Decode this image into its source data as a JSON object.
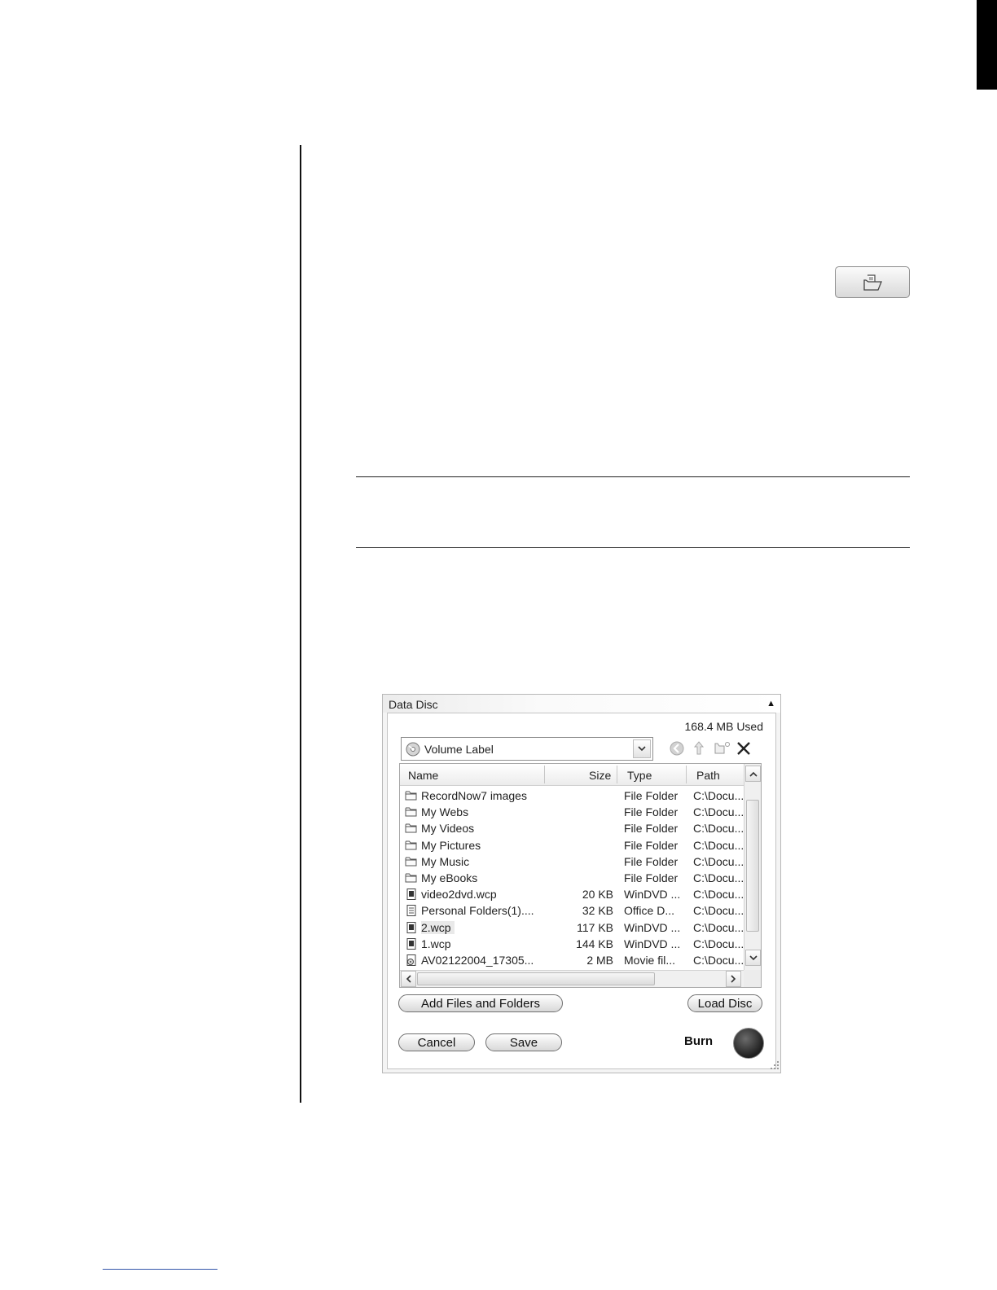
{
  "window": {
    "title": "Data Disc",
    "used": "168.4 MB Used",
    "volume_label": "Volume Label"
  },
  "columns": {
    "name": "Name",
    "size": "Size",
    "type": "Type",
    "path": "Path"
  },
  "files": [
    {
      "icon": "folder-icon",
      "name": "RecordNow7 images",
      "size": "",
      "type": "File Folder",
      "path": "C:\\Docu..."
    },
    {
      "icon": "folder-icon",
      "name": "My Webs",
      "size": "",
      "type": "File Folder",
      "path": "C:\\Docu..."
    },
    {
      "icon": "folder-icon",
      "name": "My Videos",
      "size": "",
      "type": "File Folder",
      "path": "C:\\Docu..."
    },
    {
      "icon": "folder-icon",
      "name": "My Pictures",
      "size": "",
      "type": "File Folder",
      "path": "C:\\Docu..."
    },
    {
      "icon": "folder-icon",
      "name": "My Music",
      "size": "",
      "type": "File Folder",
      "path": "C:\\Docu..."
    },
    {
      "icon": "folder-icon",
      "name": "My eBooks",
      "size": "",
      "type": "File Folder",
      "path": "C:\\Docu..."
    },
    {
      "icon": "file-icon",
      "name": "video2dvd.wcp",
      "size": "20 KB",
      "type": "WinDVD ...",
      "path": "C:\\Docu..."
    },
    {
      "icon": "document-icon",
      "name": "Personal Folders(1)....",
      "size": "32 KB",
      "type": "Office D...",
      "path": "C:\\Docu..."
    },
    {
      "icon": "file-icon",
      "name": "2.wcp",
      "size": "117 KB",
      "type": "WinDVD ...",
      "path": "C:\\Docu...",
      "selected": true
    },
    {
      "icon": "file-icon",
      "name": "1.wcp",
      "size": "144 KB",
      "type": "WinDVD ...",
      "path": "C:\\Docu..."
    },
    {
      "icon": "movie-file-icon",
      "name": "AV02122004_17305...",
      "size": "2 MB",
      "type": "Movie fil...",
      "path": "C:\\Docu..."
    }
  ],
  "buttons": {
    "add_files": "Add Files and Folders",
    "load_disc": "Load Disc",
    "cancel": "Cancel",
    "save": "Save",
    "burn": "Burn"
  }
}
